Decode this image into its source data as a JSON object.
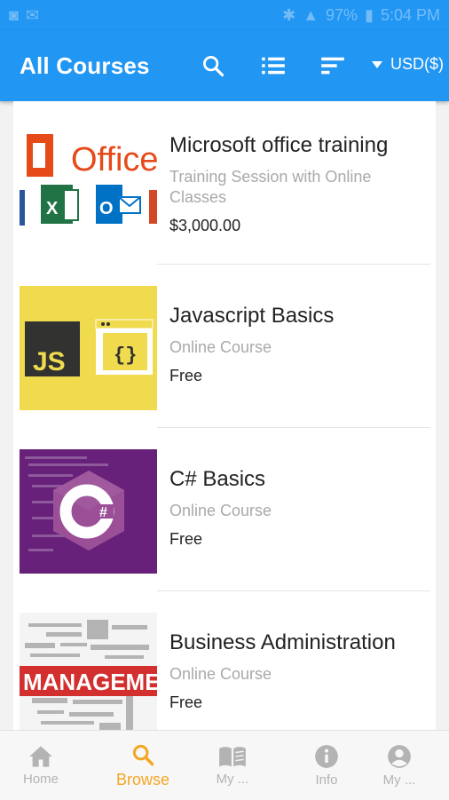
{
  "status_bar": {
    "battery": "97%",
    "time": "5:04 PM"
  },
  "app_bar": {
    "title": "All Courses",
    "currency": "USD($)"
  },
  "courses": [
    {
      "name": "Microsoft office training",
      "subtitle": "Training Session with Online Classes",
      "price": "$3,000.00",
      "logo_text": "Office"
    },
    {
      "name": "Javascript Basics",
      "subtitle": "Online Course",
      "price": "Free",
      "logo_text": "JS"
    },
    {
      "name": "C# Basics",
      "subtitle": "Online Course",
      "price": "Free"
    },
    {
      "name": "Business Administration",
      "subtitle": "Online Course",
      "price": "Free",
      "logo_text": "MANAGEMENT"
    }
  ],
  "bottom_nav": [
    {
      "label": "Home",
      "icon": "home-icon"
    },
    {
      "label": "Browse",
      "icon": "search-icon"
    },
    {
      "label": "My ...",
      "icon": "book-icon"
    },
    {
      "label": "Info",
      "icon": "info-icon"
    },
    {
      "label": "My ...",
      "icon": "account-icon"
    }
  ],
  "colors": {
    "primary": "#2196f3",
    "accent": "#f5a623",
    "inactive": "#b3b3b3"
  }
}
